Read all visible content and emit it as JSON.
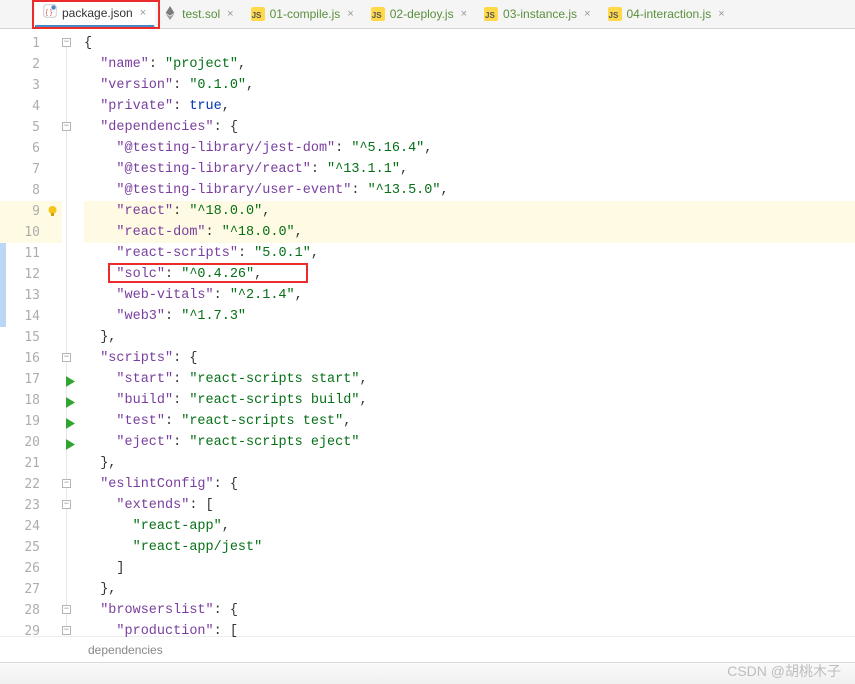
{
  "tabs": [
    {
      "label": "package.json",
      "icon": "json-icon",
      "active": true
    },
    {
      "label": "test.sol",
      "icon": "eth-icon",
      "active": false
    },
    {
      "label": "01-compile.js",
      "icon": "js-icon",
      "active": false
    },
    {
      "label": "02-deploy.js",
      "icon": "js-icon",
      "active": false
    },
    {
      "label": "03-instance.js",
      "icon": "js-icon",
      "active": false
    },
    {
      "label": "04-interaction.js",
      "icon": "js-icon",
      "active": false
    }
  ],
  "gutter": {
    "start": 1,
    "end": 29,
    "warn_line": 9,
    "run_lines": [
      17,
      18,
      19,
      20
    ],
    "highlighted_lines": [
      9,
      10
    ],
    "selection_stripe": {
      "from": 11,
      "to": 14
    }
  },
  "breadcrumb": "dependencies",
  "watermark": "CSDN @胡桃木子",
  "highlight_box_line": 12,
  "code": {
    "lines": [
      {
        "n": 1,
        "indent": 0,
        "tokens": [
          [
            "punct",
            "{"
          ]
        ]
      },
      {
        "n": 2,
        "indent": 1,
        "tokens": [
          [
            "key",
            "\"name\""
          ],
          [
            "punct",
            ": "
          ],
          [
            "str",
            "\"project\""
          ],
          [
            "punct",
            ","
          ]
        ]
      },
      {
        "n": 3,
        "indent": 1,
        "tokens": [
          [
            "key",
            "\"version\""
          ],
          [
            "punct",
            ": "
          ],
          [
            "str",
            "\"0.1.0\""
          ],
          [
            "punct",
            ","
          ]
        ]
      },
      {
        "n": 4,
        "indent": 1,
        "tokens": [
          [
            "key",
            "\"private\""
          ],
          [
            "punct",
            ": "
          ],
          [
            "kw",
            "true"
          ],
          [
            "punct",
            ","
          ]
        ]
      },
      {
        "n": 5,
        "indent": 1,
        "tokens": [
          [
            "key",
            "\"dependencies\""
          ],
          [
            "punct",
            ": {"
          ]
        ]
      },
      {
        "n": 6,
        "indent": 2,
        "tokens": [
          [
            "key",
            "\"@testing-library/jest-dom\""
          ],
          [
            "punct",
            ": "
          ],
          [
            "str",
            "\"^5.16.4\""
          ],
          [
            "punct",
            ","
          ]
        ]
      },
      {
        "n": 7,
        "indent": 2,
        "tokens": [
          [
            "key",
            "\"@testing-library/react\""
          ],
          [
            "punct",
            ": "
          ],
          [
            "str",
            "\"^13.1.1\""
          ],
          [
            "punct",
            ","
          ]
        ]
      },
      {
        "n": 8,
        "indent": 2,
        "tokens": [
          [
            "key",
            "\"@testing-library/user-event\""
          ],
          [
            "punct",
            ": "
          ],
          [
            "str",
            "\"^13.5.0\""
          ],
          [
            "punct",
            ","
          ]
        ]
      },
      {
        "n": 9,
        "indent": 2,
        "hl": "warn",
        "tokens": [
          [
            "key",
            "\"react\""
          ],
          [
            "punct",
            ": "
          ],
          [
            "str",
            "\"^18.0.0\""
          ],
          [
            "punct",
            ","
          ]
        ]
      },
      {
        "n": 10,
        "indent": 2,
        "hl": "cur",
        "tokens": [
          [
            "key",
            "\"react-dom\""
          ],
          [
            "punct",
            ": "
          ],
          [
            "str",
            "\"^18.0.0\""
          ],
          [
            "punct",
            ","
          ]
        ]
      },
      {
        "n": 11,
        "indent": 2,
        "tokens": [
          [
            "key",
            "\"react-scripts\""
          ],
          [
            "punct",
            ": "
          ],
          [
            "str",
            "\"5.0.1\""
          ],
          [
            "punct",
            ","
          ]
        ]
      },
      {
        "n": 12,
        "indent": 2,
        "tokens": [
          [
            "key",
            "\"solc\""
          ],
          [
            "punct",
            ": "
          ],
          [
            "str",
            "\"^0.4.26\""
          ],
          [
            "punct",
            ","
          ]
        ]
      },
      {
        "n": 13,
        "indent": 2,
        "tokens": [
          [
            "key",
            "\"web-vitals\""
          ],
          [
            "punct",
            ": "
          ],
          [
            "str",
            "\"^2.1.4\""
          ],
          [
            "punct",
            ","
          ]
        ]
      },
      {
        "n": 14,
        "indent": 2,
        "tokens": [
          [
            "key",
            "\"web3\""
          ],
          [
            "punct",
            ": "
          ],
          [
            "str",
            "\"^1.7.3\""
          ]
        ]
      },
      {
        "n": 15,
        "indent": 1,
        "tokens": [
          [
            "punct",
            "},"
          ]
        ]
      },
      {
        "n": 16,
        "indent": 1,
        "tokens": [
          [
            "key",
            "\"scripts\""
          ],
          [
            "punct",
            ": {"
          ]
        ]
      },
      {
        "n": 17,
        "indent": 2,
        "tokens": [
          [
            "key",
            "\"start\""
          ],
          [
            "punct",
            ": "
          ],
          [
            "str",
            "\"react-scripts start\""
          ],
          [
            "punct",
            ","
          ]
        ]
      },
      {
        "n": 18,
        "indent": 2,
        "tokens": [
          [
            "key",
            "\"build\""
          ],
          [
            "punct",
            ": "
          ],
          [
            "str",
            "\"react-scripts build\""
          ],
          [
            "punct",
            ","
          ]
        ]
      },
      {
        "n": 19,
        "indent": 2,
        "tokens": [
          [
            "key",
            "\"test\""
          ],
          [
            "punct",
            ": "
          ],
          [
            "str",
            "\"react-scripts test\""
          ],
          [
            "punct",
            ","
          ]
        ]
      },
      {
        "n": 20,
        "indent": 2,
        "tokens": [
          [
            "key",
            "\"eject\""
          ],
          [
            "punct",
            ": "
          ],
          [
            "str",
            "\"react-scripts eject\""
          ]
        ]
      },
      {
        "n": 21,
        "indent": 1,
        "tokens": [
          [
            "punct",
            "},"
          ]
        ]
      },
      {
        "n": 22,
        "indent": 1,
        "tokens": [
          [
            "key",
            "\"eslintConfig\""
          ],
          [
            "punct",
            ": {"
          ]
        ]
      },
      {
        "n": 23,
        "indent": 2,
        "tokens": [
          [
            "key",
            "\"extends\""
          ],
          [
            "punct",
            ": ["
          ]
        ]
      },
      {
        "n": 24,
        "indent": 3,
        "tokens": [
          [
            "str",
            "\"react-app\""
          ],
          [
            "punct",
            ","
          ]
        ]
      },
      {
        "n": 25,
        "indent": 3,
        "tokens": [
          [
            "str",
            "\"react-app/jest\""
          ]
        ]
      },
      {
        "n": 26,
        "indent": 2,
        "tokens": [
          [
            "punct",
            "]"
          ]
        ]
      },
      {
        "n": 27,
        "indent": 1,
        "tokens": [
          [
            "punct",
            "},"
          ]
        ]
      },
      {
        "n": 28,
        "indent": 1,
        "tokens": [
          [
            "key",
            "\"browserslist\""
          ],
          [
            "punct",
            ": {"
          ]
        ]
      },
      {
        "n": 29,
        "indent": 2,
        "tokens": [
          [
            "key",
            "\"production\""
          ],
          [
            "punct",
            ": ["
          ]
        ]
      }
    ]
  },
  "folds": [
    1,
    5,
    16,
    22,
    23,
    28,
    29
  ],
  "fold_ranges": [
    [
      1,
      29
    ],
    [
      5,
      15
    ],
    [
      16,
      21
    ],
    [
      22,
      27
    ],
    [
      23,
      26
    ],
    [
      28,
      29
    ]
  ]
}
